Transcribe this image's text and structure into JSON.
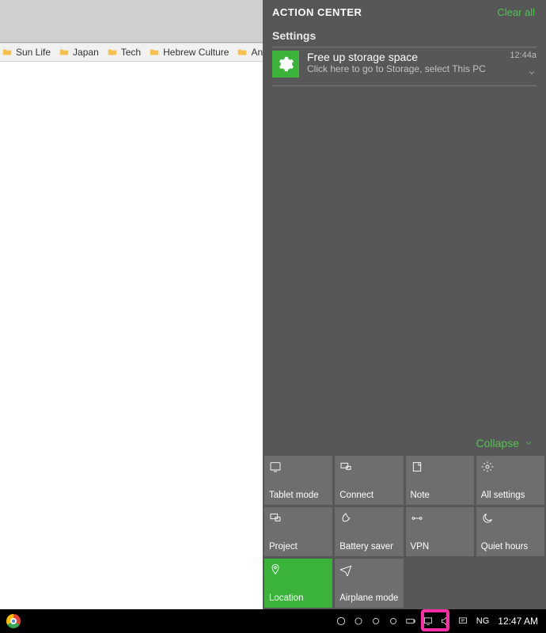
{
  "bookmarks": [
    {
      "label": "Sun Life"
    },
    {
      "label": "Japan"
    },
    {
      "label": "Tech"
    },
    {
      "label": "Hebrew Culture"
    },
    {
      "label": "Anin"
    }
  ],
  "action_center": {
    "title": "ACTION CENTER",
    "clear_all": "Clear all",
    "section": "Settings",
    "notification": {
      "title": "Free up storage space",
      "subtitle": "Click here to go to Storage, select This PC",
      "time": "12:44a"
    },
    "collapse": "Collapse",
    "tiles": [
      {
        "key": "tablet",
        "label": "Tablet mode",
        "active": false
      },
      {
        "key": "connect",
        "label": "Connect",
        "active": false
      },
      {
        "key": "note",
        "label": "Note",
        "active": false
      },
      {
        "key": "settings",
        "label": "All settings",
        "active": false
      },
      {
        "key": "project",
        "label": "Project",
        "active": false
      },
      {
        "key": "battery",
        "label": "Battery saver",
        "active": false
      },
      {
        "key": "vpn",
        "label": "VPN",
        "active": false
      },
      {
        "key": "quiet",
        "label": "Quiet hours",
        "active": false
      },
      {
        "key": "location",
        "label": "Location",
        "active": true
      },
      {
        "key": "airplane",
        "label": "Airplane mode",
        "active": false
      }
    ]
  },
  "taskbar": {
    "lang": "NG",
    "clock": "12:47 AM"
  }
}
